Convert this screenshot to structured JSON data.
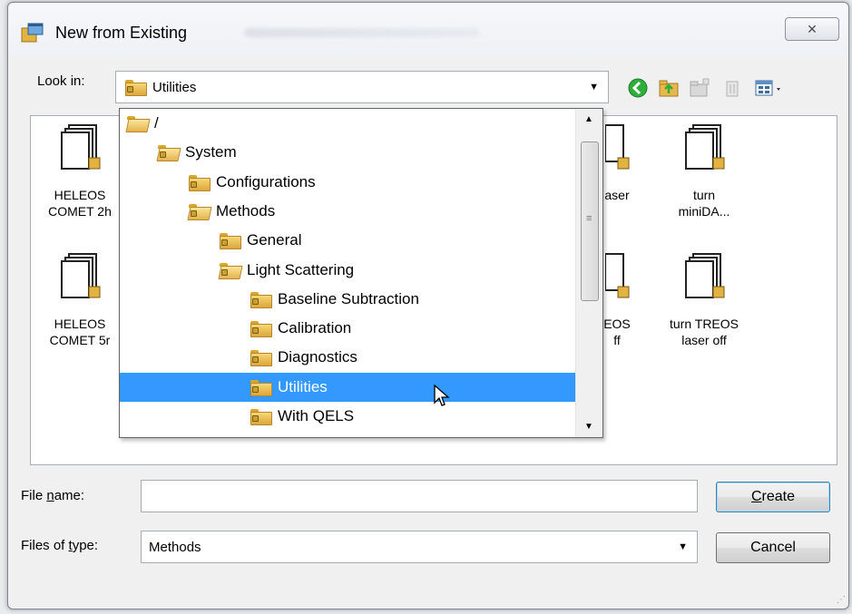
{
  "window": {
    "title": "New from Existing",
    "close_label": "✕"
  },
  "look_in": {
    "label": "Look in:",
    "value": "Utilities"
  },
  "toolbar": {
    "icons": [
      "back-icon",
      "up-folder-icon",
      "new-folder-icon",
      "delete-icon",
      "view-menu-icon"
    ]
  },
  "files": [
    {
      "line1": "HELEOS",
      "line2": "COMET 2h"
    },
    {
      "line1": "HELEOS",
      "line2": "COMET 5r"
    },
    {
      "line1": "aser",
      "line2": ""
    },
    {
      "line1": "EOS",
      "line2": "ff"
    },
    {
      "line1": "turn",
      "line2": "miniDA..."
    },
    {
      "line1": "turn TREOS",
      "line2": "laser off"
    }
  ],
  "dropdown": {
    "items": [
      {
        "label": "/",
        "indent": 0,
        "open": true,
        "lock": false
      },
      {
        "label": "System",
        "indent": 1,
        "open": true,
        "lock": true
      },
      {
        "label": "Configurations",
        "indent": 2,
        "open": false,
        "lock": true
      },
      {
        "label": "Methods",
        "indent": 2,
        "open": true,
        "lock": true
      },
      {
        "label": "General",
        "indent": 3,
        "open": false,
        "lock": true
      },
      {
        "label": "Light Scattering",
        "indent": 3,
        "open": true,
        "lock": true
      },
      {
        "label": "Baseline Subtraction",
        "indent": 4,
        "open": false,
        "lock": true
      },
      {
        "label": "Calibration",
        "indent": 4,
        "open": false,
        "lock": true
      },
      {
        "label": "Diagnostics",
        "indent": 4,
        "open": false,
        "lock": true
      },
      {
        "label": "Utilities",
        "indent": 4,
        "open": false,
        "lock": true,
        "selected": true
      },
      {
        "label": "With QELS",
        "indent": 4,
        "open": false,
        "lock": true
      }
    ]
  },
  "file_name": {
    "label_pre": "File ",
    "label_u": "n",
    "label_post": "ame:",
    "value": ""
  },
  "file_type": {
    "label_pre": "Files of ",
    "label_u": "t",
    "label_post": "ype:",
    "value": "Methods"
  },
  "buttons": {
    "create_u": "C",
    "create_rest": "reate",
    "cancel": "Cancel"
  },
  "colors": {
    "selection": "#3399ff",
    "folder": "#e4b44e"
  }
}
